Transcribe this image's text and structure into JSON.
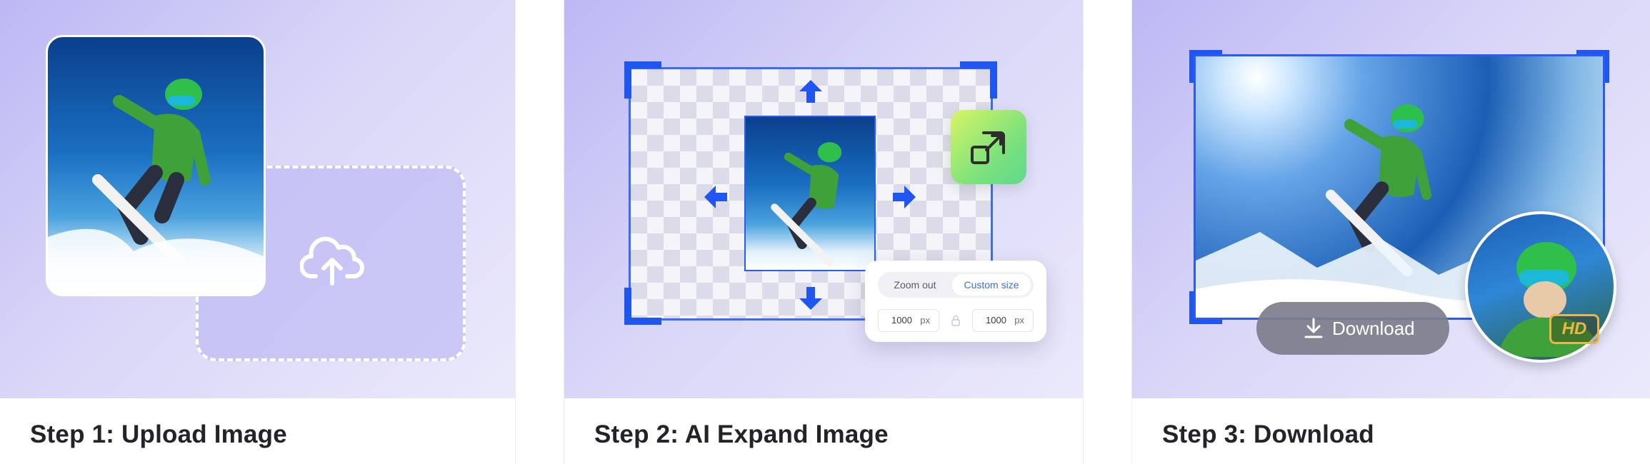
{
  "steps": [
    {
      "title": "Step 1: Upload Image"
    },
    {
      "title": "Step 2: AI Expand Image"
    },
    {
      "title": "Step 3: Download"
    }
  ],
  "expand_panel": {
    "zoom_out_label": "Zoom out",
    "custom_size_label": "Custom size",
    "width_value": "1000",
    "width_unit": "px",
    "height_value": "1000",
    "height_unit": "px"
  },
  "download": {
    "label": "Download",
    "hd_badge": "HD"
  },
  "icons": {
    "upload": "cloud-upload-icon",
    "expand": "expand-icon",
    "arrows": [
      "arrow-up-icon",
      "arrow-down-icon",
      "arrow-left-icon",
      "arrow-right-icon"
    ],
    "lock": "lock-icon",
    "download": "download-icon"
  },
  "colors": {
    "accent_blue": "#1f56f2",
    "expand_green": "#7fe27c",
    "hd_gold": "#e9b64a"
  }
}
